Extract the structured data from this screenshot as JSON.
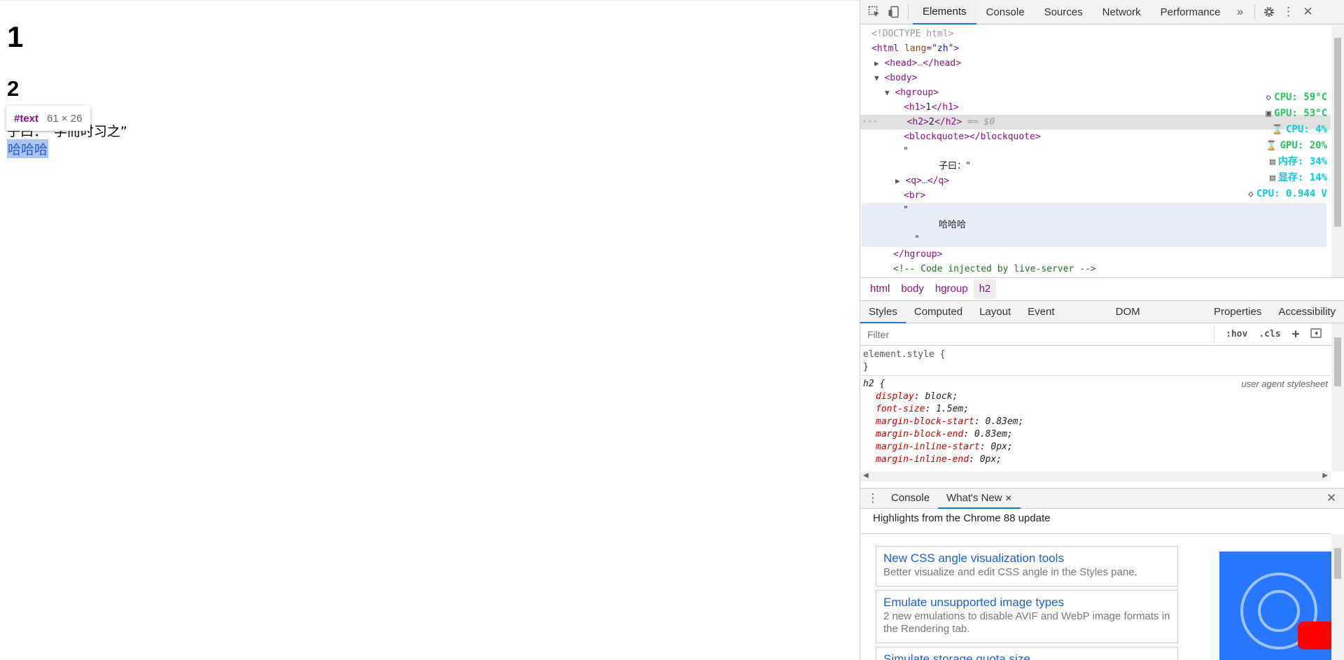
{
  "page": {
    "h1": "1",
    "h2": "2",
    "blockquote_text": "子曰：“学而时习之”",
    "selected_text": "哈哈哈",
    "tooltip": {
      "node": "#text",
      "size": "61 × 26"
    }
  },
  "devtools": {
    "tabs": [
      "Elements",
      "Console",
      "Sources",
      "Network",
      "Performance"
    ],
    "active_tab": "Elements",
    "dom_lines": [
      "<!DOCTYPE html>",
      "html",
      "lang",
      "\"zh\"",
      "head",
      "…",
      "body",
      "hgroup",
      "h1",
      "1",
      "h2",
      "2",
      "== $0",
      "blockquote",
      "\"",
      "子曰：\"",
      "q",
      "br",
      "哈哈哈",
      "Code injected by live-server"
    ],
    "monitor": [
      {
        "icon": "chip-icon",
        "label": "CPU: 59°C",
        "color": "#22c55e"
      },
      {
        "icon": "gpu-icon",
        "label": "GPU: 53°C",
        "color": "#22c55e"
      },
      {
        "icon": "hourglass-icon",
        "label": "CPU: 4%",
        "color": "#00cfe0"
      },
      {
        "icon": "hourglass-icon",
        "label": "GPU: 20%",
        "color": "#22c55e"
      },
      {
        "icon": "memory-icon",
        "label": "内存: 34%",
        "color": "#00cfe0"
      },
      {
        "icon": "memory-icon",
        "label": "显存: 14%",
        "color": "#00cfe0"
      },
      {
        "icon": "chip-icon",
        "label": "CPU: 0.944 V",
        "color": "#00cfe0"
      }
    ],
    "breadcrumbs": [
      "html",
      "body",
      "hgroup",
      "h2"
    ],
    "style_tabs": [
      "Styles",
      "Computed",
      "Layout",
      "Event Listeners",
      "DOM Breakpoints",
      "Properties",
      "Accessibility"
    ],
    "filter_placeholder": "Filter",
    "hov": ":hov",
    "cls": ".cls",
    "styles": {
      "element_style": "element.style {",
      "close": "}",
      "h2_selector": "h2 {",
      "ua_label": "user agent stylesheet",
      "props": [
        {
          "name": "display",
          "value": "block;"
        },
        {
          "name": "font-size",
          "value": "1.5em;"
        },
        {
          "name": "margin-block-start",
          "value": "0.83em;"
        },
        {
          "name": "margin-block-end",
          "value": "0.83em;"
        },
        {
          "name": "margin-inline-start",
          "value": "0px;"
        },
        {
          "name": "margin-inline-end",
          "value": "0px;"
        }
      ]
    },
    "drawer_tabs": [
      "Console",
      "What's New"
    ],
    "highlights": "Highlights from the Chrome 88 update",
    "cards": [
      {
        "title": "New CSS angle visualization tools",
        "desc": "Better visualize and edit CSS angle in the Styles pane."
      },
      {
        "title": "Emulate unsupported image types",
        "desc": "2 new emulations to disable AVIF and WebP image formats in the Rendering tab."
      },
      {
        "title": "Simulate storage quota size",
        "desc": ""
      }
    ]
  }
}
